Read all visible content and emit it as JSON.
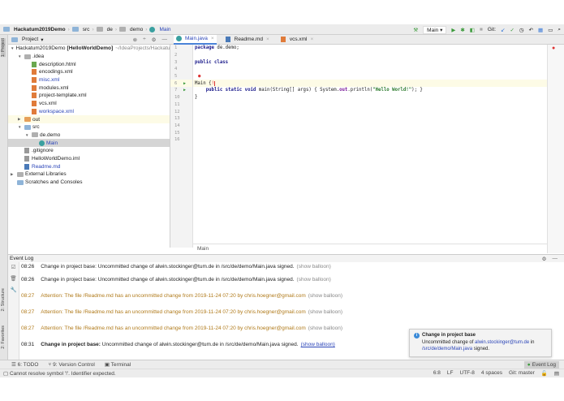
{
  "breadcrumb": [
    "Hackatum2019Demo",
    "src",
    "de",
    "demo",
    "Main"
  ],
  "toolbar": {
    "run_config": "Main",
    "git_label": "Git:"
  },
  "project_panel": {
    "title": "Project",
    "tree": [
      {
        "label": "Hackatum2019Demo",
        "bold_suffix": "[HelloWorldDemo]",
        "path": "~/IdeaProjects/Hackatu...",
        "depth": 0,
        "arrow": "▼",
        "icon": "folder"
      },
      {
        "label": ".idea",
        "depth": 1,
        "arrow": "▼",
        "icon": "folder-gray"
      },
      {
        "label": "description.html",
        "depth": 2,
        "icon": "html"
      },
      {
        "label": "encodings.xml",
        "depth": 2,
        "icon": "xml"
      },
      {
        "label": "misc.xml",
        "depth": 2,
        "icon": "xml",
        "modified": true
      },
      {
        "label": "modules.xml",
        "depth": 2,
        "icon": "xml"
      },
      {
        "label": "project-template.xml",
        "depth": 2,
        "icon": "xml"
      },
      {
        "label": "vcs.xml",
        "depth": 2,
        "icon": "xml"
      },
      {
        "label": "workspace.xml",
        "depth": 2,
        "icon": "xml",
        "modified": true
      },
      {
        "label": "out",
        "depth": 1,
        "arrow": "▶",
        "icon": "folder-orange",
        "highlight": true
      },
      {
        "label": "src",
        "depth": 1,
        "arrow": "▼",
        "icon": "folder"
      },
      {
        "label": "de.demo",
        "depth": 2,
        "arrow": "▼",
        "icon": "folder-gray"
      },
      {
        "label": "Main",
        "depth": 3,
        "icon": "class",
        "modified": true,
        "selected": true
      },
      {
        "label": ".gitignore",
        "depth": 1,
        "icon": "gray"
      },
      {
        "label": "HelloWorldDemo.iml",
        "depth": 1,
        "icon": "gray"
      },
      {
        "label": "Readme.md",
        "depth": 1,
        "icon": "md",
        "modified": true
      },
      {
        "label": "External Libraries",
        "depth": 0,
        "arrow": "▶",
        "icon": "lib"
      },
      {
        "label": "Scratches and Consoles",
        "depth": 0,
        "icon": "scratch"
      }
    ]
  },
  "tabs": [
    {
      "label": "Main.java",
      "active": true
    },
    {
      "label": "Readme.md"
    },
    {
      "label": "vcs.xml"
    }
  ],
  "editor": {
    "line_numbers": [
      "1",
      "2",
      "3",
      "4",
      "5",
      "6",
      "7",
      "10",
      "11",
      "12",
      "13",
      "14",
      "15",
      "16"
    ],
    "lines": [
      [
        {
          "t": "package",
          "c": "kw"
        },
        {
          "t": " de.demo;"
        }
      ],
      [],
      [
        {
          "t": "public class",
          "c": "kw"
        }
      ],
      [],
      [],
      [
        {
          "t": "Main {"
        },
        {
          "t": "!",
          "c": "err"
        }
      ],
      [
        {
          "t": "    "
        },
        {
          "t": "public static void",
          "c": "kw"
        },
        {
          "t": " main(String[] args) { System."
        },
        {
          "t": "out",
          "c": "fld"
        },
        {
          "t": ".println("
        },
        {
          "t": "\"Hello World!\"",
          "c": "str"
        },
        {
          "t": "); }"
        }
      ],
      [
        {
          "t": "}"
        }
      ],
      [],
      [],
      [],
      [],
      [],
      []
    ],
    "breadcrumb": "Main"
  },
  "left_tools": [
    "1: Project",
    "2: Structure",
    "2: Favorites"
  ],
  "event_log": {
    "title": "Event Log",
    "entries": [
      {
        "time": "08:26",
        "text": "Change in project base: Uncommitted change of alwin.stockinger@tum.de in /src/de/demo/Main.java signed.",
        "link": "(show balloon)",
        "type": "info"
      },
      {
        "time": "08:26",
        "text": "Change in project base: Uncommitted change of alwin.stockinger@tum.de in /src/de/demo/Main.java signed.",
        "link": "(show balloon)",
        "type": "info"
      },
      {
        "time": "08:27",
        "text": "Attention: The file /Readme.md has an uncommitted change from 2019-11-24 07:20 by chris.hoegner@gmail.com",
        "link": "(show balloon)",
        "type": "warn"
      },
      {
        "time": "08:27",
        "text": "Attention: The file /Readme.md has an uncommitted change from 2019-11-24 07:20 by chris.hoegner@gmail.com",
        "link": "(show balloon)",
        "type": "warn"
      },
      {
        "time": "08:27",
        "text": "Attention: The file /Readme.md has an uncommitted change from 2019-11-24 07:20 by chris.hoegner@gmail.com",
        "link": "(show balloon)",
        "type": "warn"
      },
      {
        "time": "08:31",
        "bold": "Change in project base:",
        "text": " Uncommitted change of alwin.stockinger@tum.de in /src/de/demo/Main.java signed.",
        "link": "(show balloon)",
        "type": "new"
      }
    ]
  },
  "balloon": {
    "title": "Change in project base",
    "pre": "Uncommitted change of ",
    "email": "alwin.stockinger@tum.de",
    "mid": " in ",
    "path": "/src/de/demo/Main.java",
    "post": " signed."
  },
  "bottom_tools": [
    "6: TODO",
    "9: Version Control",
    "Terminal"
  ],
  "event_log_button": "Event Log",
  "status": {
    "message": "Cannot resolve symbol '!'. Identifier expected.",
    "position": "6:8",
    "line_sep": "LF",
    "encoding": "UTF-8",
    "indent": "4 spaces",
    "branch": "Git: master"
  }
}
